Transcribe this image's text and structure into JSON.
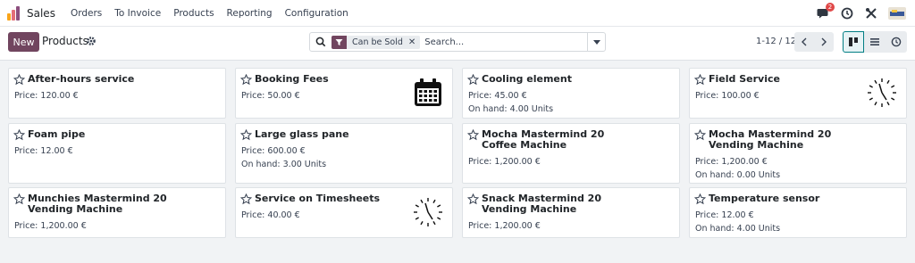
{
  "navbar": {
    "app_name": "Sales",
    "menu": [
      "Orders",
      "To Invoice",
      "Products",
      "Reporting",
      "Configuration"
    ],
    "messages_count": "2",
    "logo_colors": [
      "#f9a51a",
      "#e46f78",
      "#8c4f7e"
    ]
  },
  "control_panel": {
    "new_label": "New",
    "breadcrumb": "Products",
    "search": {
      "facet_label": "Can be Sold",
      "facet_remove": "✕",
      "placeholder": "Search..."
    },
    "pager": {
      "value": "1-12 / 12"
    },
    "views": [
      "kanban",
      "list",
      "activity"
    ],
    "active_view": "kanban"
  },
  "accent_color": "#71455f",
  "products": [
    {
      "name": "After-hours service",
      "price": "Price: 120.00 €",
      "on_hand": "",
      "image": "none"
    },
    {
      "name": "Booking Fees",
      "price": "Price: 50.00 €",
      "on_hand": "",
      "image": "calendar-icon"
    },
    {
      "name": "Cooling element",
      "price": "Price: 45.00 €",
      "on_hand": "On hand: 4.00 Units",
      "image": "none"
    },
    {
      "name": "Field Service",
      "price": "Price: 100.00 €",
      "on_hand": "",
      "image": "clock-icon"
    },
    {
      "name": "Foam pipe",
      "price": "Price: 12.00 €",
      "on_hand": "",
      "image": "none"
    },
    {
      "name": "Large glass pane",
      "price": "Price: 600.00 €",
      "on_hand": "On hand: 3.00 Units",
      "image": "none"
    },
    {
      "name": "Mocha Mastermind 20 Coffee Machine",
      "price": "Price: 1,200.00 €",
      "on_hand": "",
      "image": "none"
    },
    {
      "name": "Mocha Mastermind 20 Vending Machine",
      "price": "Price: 1,200.00 €",
      "on_hand": "On hand: 0.00 Units",
      "image": "none"
    },
    {
      "name": "Munchies Mastermind 20 Vending Machine",
      "price": "Price: 1,200.00 €",
      "on_hand": "",
      "image": "none"
    },
    {
      "name": "Service on Timesheets",
      "price": "Price: 40.00 €",
      "on_hand": "",
      "image": "clock-icon"
    },
    {
      "name": "Snack Mastermind 20 Vending Machine",
      "price": "Price: 1,200.00 €",
      "on_hand": "",
      "image": "none"
    },
    {
      "name": "Temperature sensor",
      "price": "Price: 12.00 €",
      "on_hand": "On hand: 4.00 Units",
      "image": "none"
    }
  ]
}
